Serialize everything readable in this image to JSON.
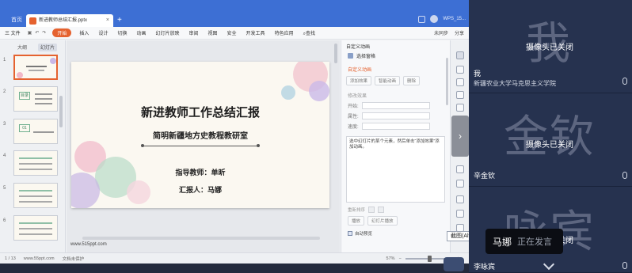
{
  "tabs": {
    "home": "首页",
    "document": "新进教师总结汇报.pptx",
    "user": "WPS_15..."
  },
  "ribbon": {
    "menu": "三 文件",
    "start": "开始",
    "items": [
      "插入",
      "设计",
      "切换",
      "动画",
      "幻灯片放映",
      "审阅",
      "视图",
      "安全",
      "开发工具",
      "特色应用"
    ],
    "search": "查找",
    "right": [
      "未同步",
      "分享"
    ]
  },
  "left_panel": {
    "tab_outline": "大纲",
    "tab_slides": "幻灯片",
    "thumbs": [
      {
        "num": "1",
        "tag": ""
      },
      {
        "num": "2",
        "tag": "目录"
      },
      {
        "num": "3",
        "tag": "01"
      },
      {
        "num": "4",
        "tag": ""
      },
      {
        "num": "5",
        "tag": ""
      },
      {
        "num": "6",
        "tag": ""
      }
    ]
  },
  "slide": {
    "title": "新进教师工作总结汇报",
    "subtitle": "简明新疆地方史教程教研室",
    "teacher": "指导教师：单昕",
    "reporter": "汇报人：马娜",
    "url": "www.515ppt.com"
  },
  "anim_pane": {
    "header": "自定义动画",
    "select_pane": "选择窗格",
    "section": "自定义动画",
    "add_effect": "添加效果",
    "smart_anim": "智能动画",
    "delete": "删除",
    "modify_label": "修改效果",
    "field_start": "开始:",
    "field_property": "属性:",
    "field_speed": "速度:",
    "list_hint": "选中幻灯片的某个元素，然后单击“添加效果”添加动画。",
    "reorder": "重新排序",
    "play": "播放",
    "slideshow": "幻灯片播放",
    "autopreview": "自动预览"
  },
  "statusbar": {
    "page": "1 / 13",
    "site": "www.55ppt.com",
    "backup": "文档未保护",
    "zoom": "57%"
  },
  "tooltip": "截图(Alt + A)",
  "meeting": {
    "participants": [
      {
        "avatar": "我",
        "status": "摄像头已关闭",
        "name": "我",
        "org": "新疆农业大学马克思主义学院"
      },
      {
        "avatar": "金钦",
        "status": "摄像头已关闭",
        "name": "辛金钦",
        "org": ""
      },
      {
        "avatar": "咏宾",
        "status": "摄像头已关闭",
        "name": "李咏宾",
        "org": ""
      }
    ],
    "speaker": {
      "name": "马娜",
      "label": "正在发言"
    }
  },
  "colors": {
    "accent": "#e5622f",
    "wps_blue": "#3d6fd4",
    "meeting_bg": "#1f2a44"
  }
}
